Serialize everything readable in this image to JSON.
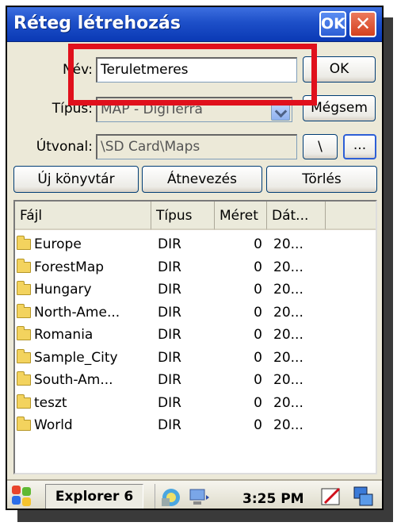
{
  "window": {
    "title": "Réteg létrehozás",
    "ok_label": "OK",
    "close_symbol": "✕"
  },
  "form": {
    "name_label": "Név:",
    "name_value": "Teruletmeres",
    "type_label": "Típus:",
    "type_value": "MAP - DigiTerra",
    "path_label": "Útvonal:",
    "path_value": "\\SD Card\\Maps",
    "ok_button": "OK",
    "cancel_button": "Mégsem",
    "root_button": "\\",
    "browse_button": "..."
  },
  "actions": {
    "new_dir": "Új könyvtár",
    "rename": "Átnevezés",
    "delete": "Törlés"
  },
  "list": {
    "columns": [
      "Fájl",
      "Típus",
      "Méret",
      "Dát..."
    ],
    "rows": [
      {
        "name": "Europe",
        "type": "DIR",
        "size": "0",
        "date": "20..."
      },
      {
        "name": "ForestMap",
        "type": "DIR",
        "size": "0",
        "date": "20..."
      },
      {
        "name": "Hungary",
        "type": "DIR",
        "size": "0",
        "date": "20..."
      },
      {
        "name": "North-Ame...",
        "type": "DIR",
        "size": "0",
        "date": "20..."
      },
      {
        "name": "Romania",
        "type": "DIR",
        "size": "0",
        "date": "20..."
      },
      {
        "name": "Sample_City",
        "type": "DIR",
        "size": "0",
        "date": "20..."
      },
      {
        "name": "South-Am...",
        "type": "DIR",
        "size": "0",
        "date": "20..."
      },
      {
        "name": "teszt",
        "type": "DIR",
        "size": "0",
        "date": "20..."
      },
      {
        "name": "World",
        "type": "DIR",
        "size": "0",
        "date": "20..."
      }
    ]
  },
  "taskbar": {
    "app": "Explorer 6",
    "time": "3:25 PM"
  },
  "colors": {
    "titlebar": "#1d4fc8",
    "highlight_box": "#e0101c",
    "folder": "#f3d35e"
  },
  "icons": [
    "start-flag-icon",
    "network-icon",
    "sync-icon",
    "pen-icon",
    "windows-icon"
  ]
}
